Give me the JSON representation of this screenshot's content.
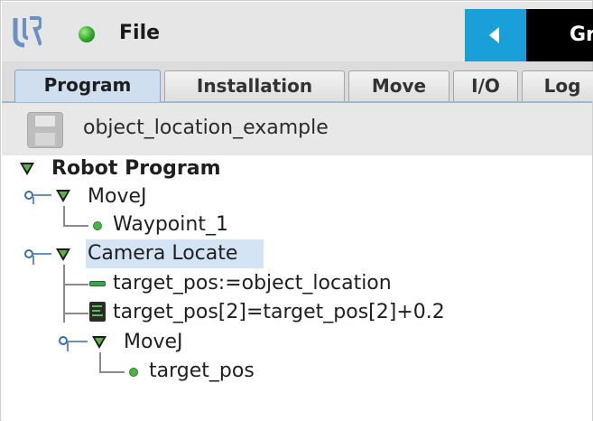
{
  "header": {
    "file_label": "File",
    "right_panel_text": "Gr"
  },
  "tabs": [
    {
      "label": "Program",
      "active": true
    },
    {
      "label": "Installation",
      "active": false
    },
    {
      "label": "Move",
      "active": false
    },
    {
      "label": "I/O",
      "active": false
    },
    {
      "label": "Log",
      "active": false
    }
  ],
  "program": {
    "name": "object_location_example"
  },
  "tree": {
    "root": "Robot Program",
    "movej_1": "MoveJ",
    "waypoint_1": "Waypoint_1",
    "camera_locate": "Camera Locate",
    "assign": "target_pos:=object_location",
    "script": "target_pos[2]=target_pos[2]+0.2",
    "movej_2": "MoveJ",
    "target_pos": "target_pos"
  },
  "icons": {
    "logo": "ur-logo-icon",
    "status": "globe-status-icon",
    "back": "back-arrow-icon",
    "save": "save-disk-icon",
    "collapse": "expand-triangle-icon",
    "waypoint": "waypoint-dot-icon",
    "assign": "assignment-icon",
    "script": "script-icon"
  },
  "colors": {
    "accent_blue": "#1aa0d8",
    "selected_row": "#d4e4f5",
    "active_tab": "#cfdff0",
    "waypoint_green": "#4bb24a"
  }
}
